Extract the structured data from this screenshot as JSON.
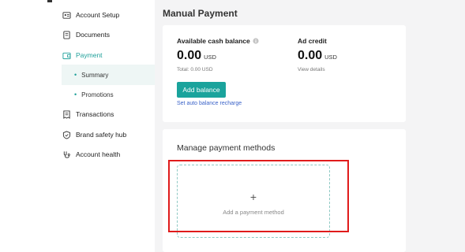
{
  "sidebar": {
    "items": [
      {
        "label": "Account Setup",
        "icon": "id-card-icon"
      },
      {
        "label": "Documents",
        "icon": "document-icon"
      },
      {
        "label": "Payment",
        "icon": "wallet-icon"
      },
      {
        "label": "Summary"
      },
      {
        "label": "Promotions"
      },
      {
        "label": "Transactions",
        "icon": "receipt-icon"
      },
      {
        "label": "Brand safety hub",
        "icon": "shield-icon"
      },
      {
        "label": "Account health",
        "icon": "stethoscope-icon"
      }
    ]
  },
  "main": {
    "title": "Manual Payment",
    "balance": {
      "available_label": "Available cash balance",
      "available_amount": "0.00",
      "available_currency": "USD",
      "total_text": "Total: 0.00 USD",
      "add_button": "Add balance",
      "auto_link": "Set auto balance recharge",
      "ad_credit_label": "Ad credit",
      "ad_credit_amount": "0.00",
      "ad_credit_currency": "USD",
      "view_details": "View details"
    },
    "methods": {
      "title": "Manage payment methods",
      "plus": "+",
      "add_text": "Add a payment method"
    }
  },
  "colors": {
    "accent": "#1aa39c",
    "link": "#3a62c8",
    "highlight": "#e01b1b"
  }
}
